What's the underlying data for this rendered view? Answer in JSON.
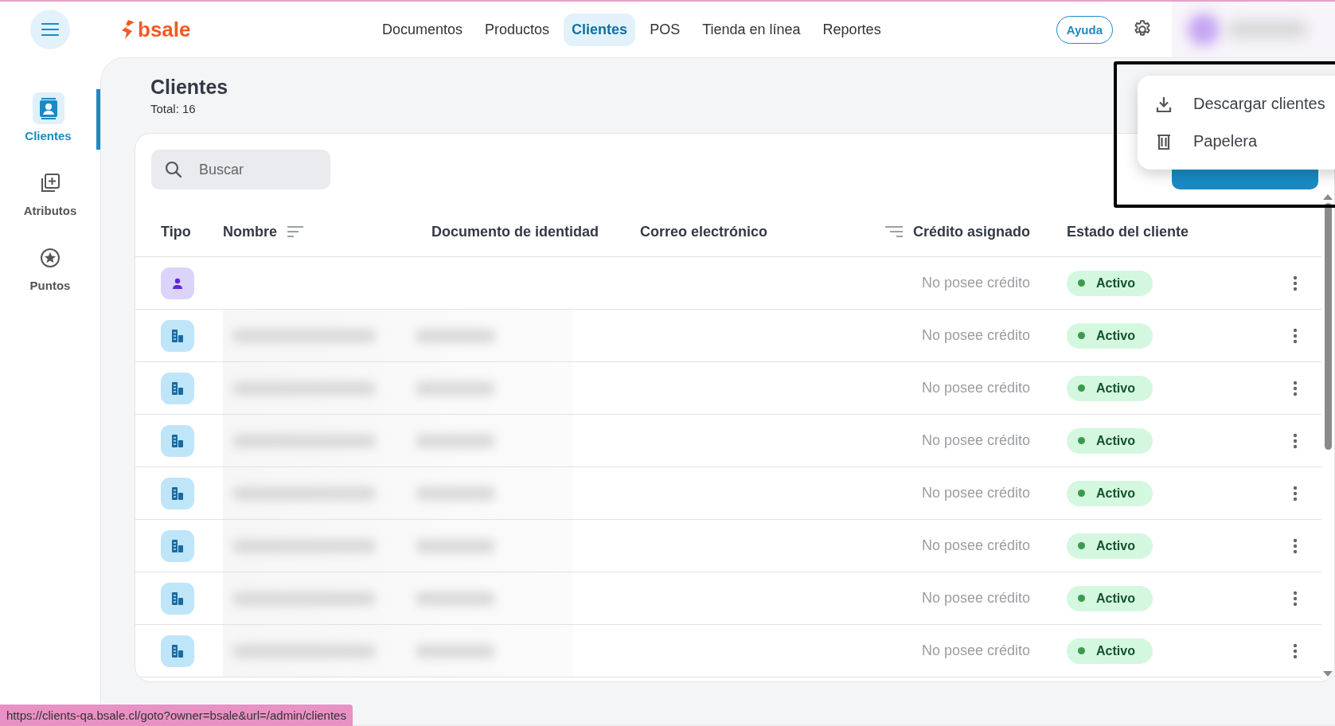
{
  "top_bar": {
    "logo": "bsale",
    "nav": [
      {
        "label": "Documentos",
        "selected": false
      },
      {
        "label": "Productos",
        "selected": false
      },
      {
        "label": "Clientes",
        "selected": true
      },
      {
        "label": "POS",
        "selected": false
      },
      {
        "label": "Tienda en línea",
        "selected": false
      },
      {
        "label": "Reportes",
        "selected": false
      }
    ],
    "help_button": "Ayuda"
  },
  "sidebar": {
    "items": [
      {
        "label": "Clientes",
        "selected": true
      },
      {
        "label": "Atributos",
        "selected": false
      },
      {
        "label": "Puntos",
        "selected": false
      }
    ]
  },
  "page": {
    "title": "Clientes",
    "total": "Total: 16"
  },
  "search": {
    "placeholder": "Buscar"
  },
  "menu": {
    "items": [
      {
        "label": "Descargar clientes"
      },
      {
        "label": "Papelera"
      }
    ]
  },
  "table": {
    "columns": [
      "Tipo",
      "Nombre",
      "Documento de identidad",
      "Correo electrónico",
      "Crédito asignado",
      "Estado del cliente"
    ],
    "rows": [
      {
        "kind": "person",
        "credit": "No posee crédito",
        "status": "Activo"
      },
      {
        "kind": "company",
        "credit": "No posee crédito",
        "status": "Activo"
      },
      {
        "kind": "company",
        "credit": "No posee crédito",
        "status": "Activo"
      },
      {
        "kind": "company",
        "credit": "No posee crédito",
        "status": "Activo"
      },
      {
        "kind": "company",
        "credit": "No posee crédito",
        "status": "Activo"
      },
      {
        "kind": "company",
        "credit": "No posee crédito",
        "status": "Activo"
      },
      {
        "kind": "company",
        "credit": "No posee crédito",
        "status": "Activo"
      },
      {
        "kind": "company",
        "credit": "No posee crédito",
        "status": "Activo"
      }
    ]
  },
  "status_bar": {
    "url": "https://clients-qa.bsale.cl/goto?owner=bsale&url=/admin/clientes"
  }
}
